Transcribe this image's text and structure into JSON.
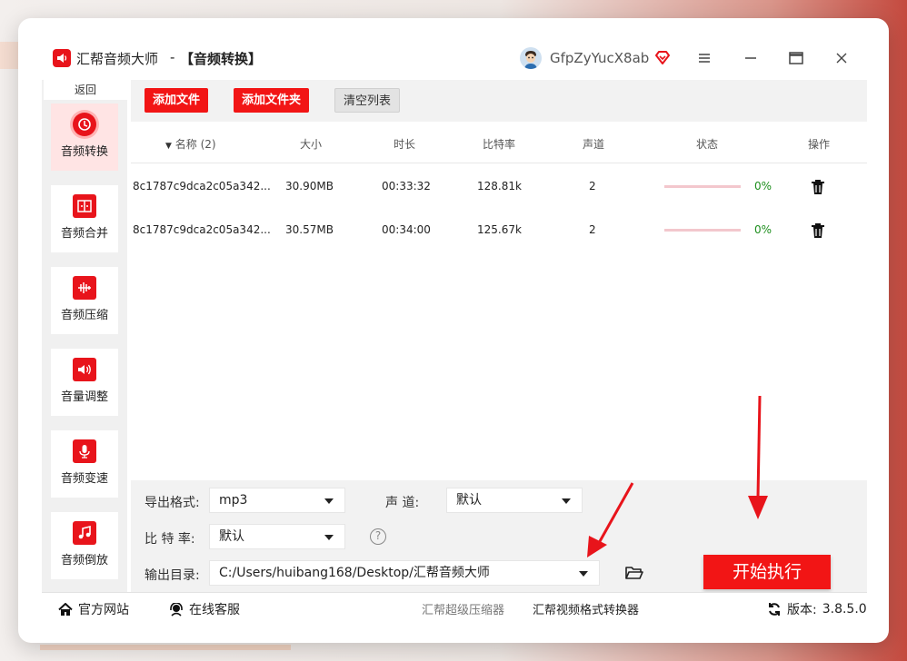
{
  "header": {
    "app_name": "汇帮音频大师",
    "separator": "-",
    "sub_title": "【音频转换】",
    "username": "GfpZyYucX8ab"
  },
  "sidebar": {
    "back_label": "返回",
    "items": [
      {
        "label": "音频转换",
        "icon": "audio-convert-icon",
        "active": true
      },
      {
        "label": "音频合并",
        "icon": "audio-merge-icon",
        "active": false
      },
      {
        "label": "音频压缩",
        "icon": "audio-compress-icon",
        "active": false
      },
      {
        "label": "音量调整",
        "icon": "volume-icon",
        "active": false
      },
      {
        "label": "音频变速",
        "icon": "microphone-icon",
        "active": false
      },
      {
        "label": "音频倒放",
        "icon": "music-note-icon",
        "active": false
      }
    ]
  },
  "toolbar": {
    "add_file": "添加文件",
    "add_folder": "添加文件夹",
    "clear_list": "清空列表"
  },
  "table": {
    "columns": {
      "name": "名称 (2)",
      "size": "大小",
      "duration": "时长",
      "bitrate": "比特率",
      "channels": "声道",
      "status": "状态",
      "action": "操作"
    },
    "rows": [
      {
        "name": "8c1787c9dca2c05a342...",
        "size": "30.90MB",
        "duration": "00:33:32",
        "bitrate": "128.81k",
        "channels": "2",
        "progress": "0%"
      },
      {
        "name": "8c1787c9dca2c05a342...",
        "size": "30.57MB",
        "duration": "00:34:00",
        "bitrate": "125.67k",
        "channels": "2",
        "progress": "0%"
      }
    ]
  },
  "settings": {
    "format_label": "导出格式:",
    "format_value": "mp3",
    "channel_label": "声 道:",
    "channel_value": "默认",
    "bitrate_label": "比 特 率:",
    "bitrate_value": "默认",
    "help_symbol": "?",
    "output_label": "输出目录:",
    "output_value": "C:/Users/huibang168/Desktop/汇帮音频大师",
    "start_label": "开始执行"
  },
  "footer": {
    "website": "官方网站",
    "support": "在线客服",
    "link1": "汇帮超级压缩器",
    "link2": "汇帮视频格式转换器",
    "version_label": "版本:",
    "version_value": "3.8.5.0"
  },
  "colors": {
    "accent": "#f21515",
    "progress_text": "#1e8f1e",
    "annotation_arrow": "#e8141b"
  }
}
